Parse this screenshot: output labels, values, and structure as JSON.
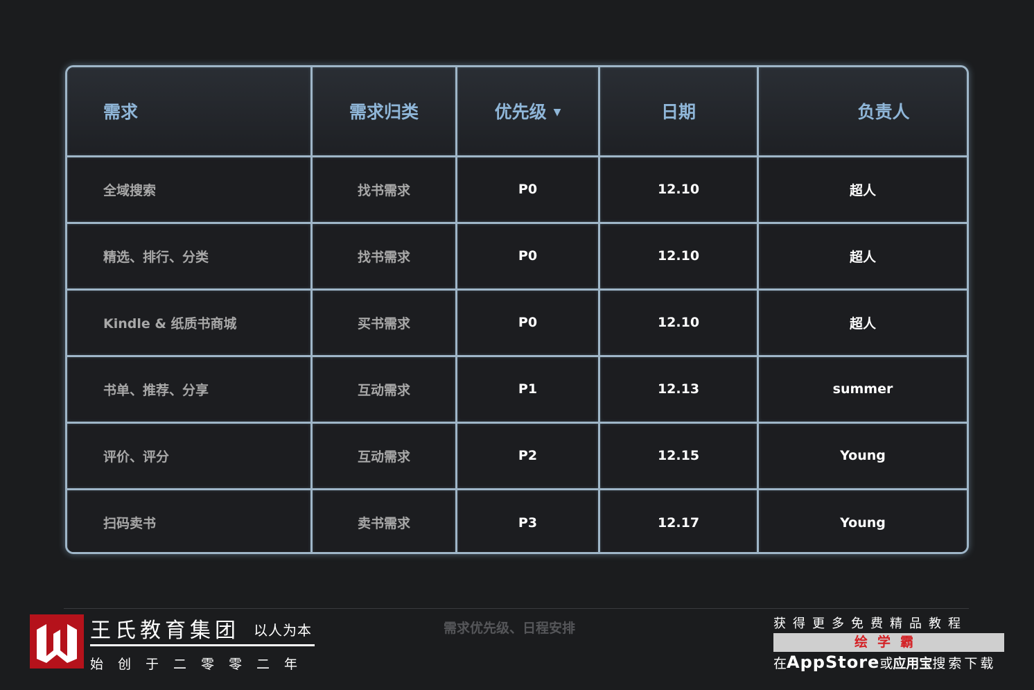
{
  "table": {
    "headers": {
      "requirement": "需求",
      "category": "需求归类",
      "priority": "优先级",
      "date": "日期",
      "owner": "负责人"
    },
    "rows": [
      {
        "requirement": "全域搜索",
        "category": "找书需求",
        "priority": "P0",
        "date": "12.10",
        "owner": "超人"
      },
      {
        "requirement": "精选、排行、分类",
        "category": "找书需求",
        "priority": "P0",
        "date": "12.10",
        "owner": "超人"
      },
      {
        "requirement": "Kindle & 纸质书商城",
        "category": "买书需求",
        "priority": "P0",
        "date": "12.10",
        "owner": "超人"
      },
      {
        "requirement": "书单、推荐、分享",
        "category": "互动需求",
        "priority": "P1",
        "date": "12.13",
        "owner": "summer"
      },
      {
        "requirement": "评价、评分",
        "category": "互动需求",
        "priority": "P2",
        "date": "12.15",
        "owner": "Young"
      },
      {
        "requirement": "扫码卖书",
        "category": "卖书需求",
        "priority": "P3",
        "date": "12.17",
        "owner": "Young"
      }
    ],
    "sort_icon": "triangle-down-icon"
  },
  "footer": {
    "brand_name": "王氏教育集团",
    "slogan": "以人为本",
    "tagline": "始创于二零零二年",
    "caption": "需求优先级、日程安排",
    "promo_line1": "获得更多免费精品教程",
    "promo_app_name": "绘学霸",
    "promo_prefix": "在",
    "promo_store1": "AppStore",
    "promo_or": "或",
    "promo_store2": "应用宝",
    "promo_suffix": "搜索下载"
  },
  "colors": {
    "background": "#1b1c1e",
    "grid_line": "#9fb6c8",
    "header_text": "#8fb6d8",
    "brand_red": "#b5121b",
    "promo_red": "#d41f23"
  }
}
